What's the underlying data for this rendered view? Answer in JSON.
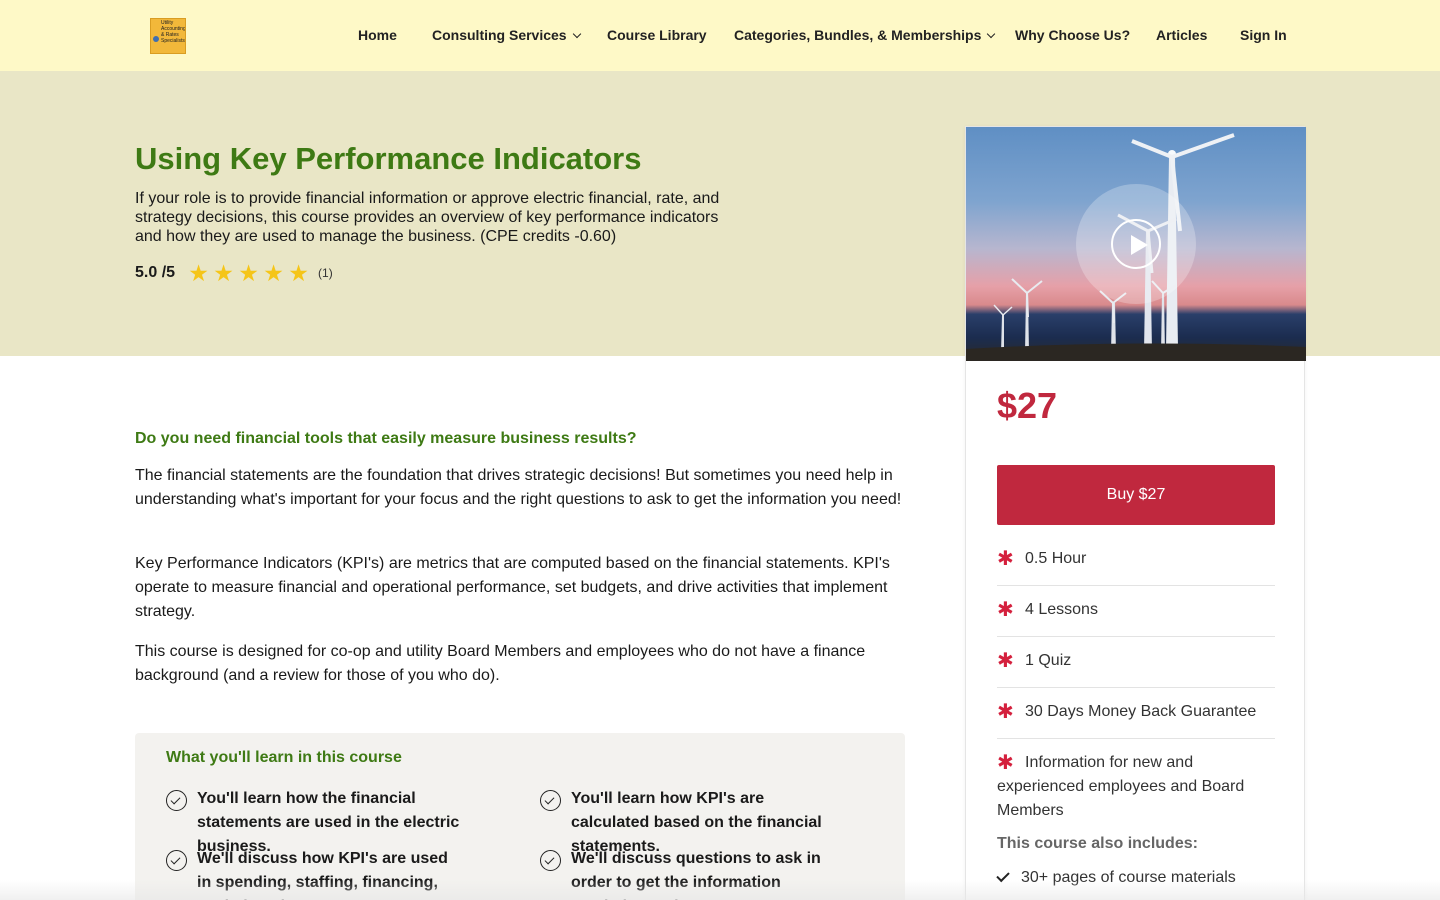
{
  "brand": {
    "logo_lines": [
      "Utility",
      "Accounting",
      "& Rates",
      "Specialists"
    ],
    "logo_icon": "globe-icon"
  },
  "nav": {
    "home": "Home",
    "consulting": "Consulting Services",
    "library": "Course Library",
    "categories": "Categories, Bundles, & Memberships",
    "why": "Why Choose Us?",
    "articles": "Articles",
    "signin": "Sign In"
  },
  "hero": {
    "title": "Using Key Performance Indicators",
    "description": "If your role is to provide financial information or approve electric financial, rate, and strategy decisions, this course provides an overview of key performance indicators and how they are used to manage the business. (CPE credits -0.60)",
    "rating_score": "5.0 /5",
    "rating_value": 5,
    "rating_max": 5,
    "rating_count": "(1)"
  },
  "sidebar": {
    "price": "$27",
    "buy_label": "Buy $27",
    "features": [
      "0.5 Hour",
      "4 Lessons",
      "1 Quiz",
      "30 Days Money Back Guarantee",
      "Information for new and experienced employees and Board Members"
    ],
    "includes_title": "This course also includes:",
    "includes": [
      "30+ pages of course materials"
    ]
  },
  "main": {
    "heading": "Do you need financial tools that easily measure business results?",
    "paragraphs": [
      "The financial statements are the foundation that drives strategic decisions! But sometimes you need help in understanding what's important for your focus and the right questions to ask to get the information you need!",
      "Key Performance Indicators (KPI's) are metrics that are computed based on the financial statements. KPI's operate to measure financial and operational performance, set budgets, and drive activities that implement strategy.",
      "This course is designed for co-op and utility Board Members and employees who do not have a finance background (and a review for those of you who do)."
    ],
    "learn_title": "What you'll learn in this course",
    "learn_items": [
      "You'll learn how the financial statements are used in the electric business.",
      "You'll learn how KPI's are calculated based on the financial statements.",
      "We'll discuss how KPI's are used in spending, staffing, financing, capital, and",
      "We'll discuss questions to ask in order to get the information needed to make rate"
    ]
  },
  "colors": {
    "nav_bg": "#fef9c7",
    "hero_bg": "#e9e6c6",
    "title_green": "#3e7a14",
    "accent_red": "#c0283e",
    "star_gold": "#f5c518"
  }
}
